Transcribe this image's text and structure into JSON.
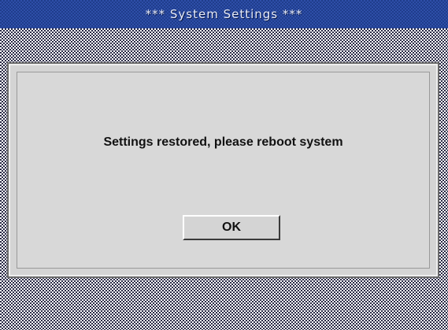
{
  "window": {
    "title": "*** System Settings ***"
  },
  "dialog": {
    "message": "Settings restored, please reboot system",
    "ok_label": "OK"
  },
  "colors": {
    "title_bar": "#1f3d8c",
    "dialog_bg": "#d4d4d4",
    "text": "#111111"
  }
}
